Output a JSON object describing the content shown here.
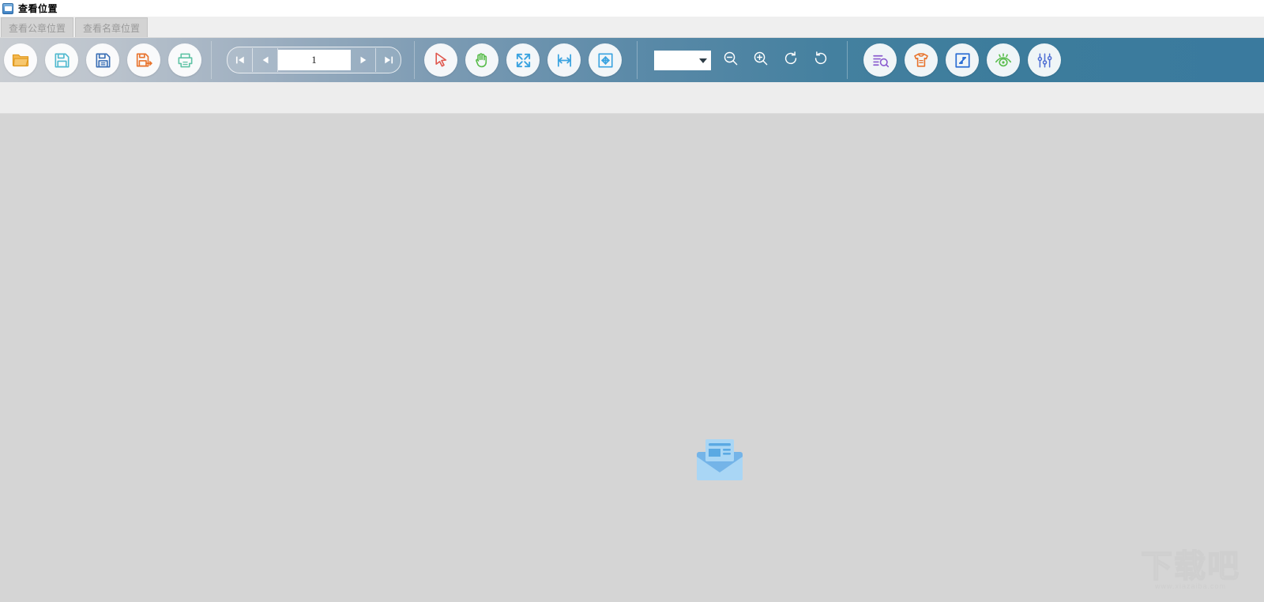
{
  "window": {
    "title": "查看位置",
    "app_icon": "app-window-icon"
  },
  "tabs": [
    {
      "id": "tab-official-seal",
      "label": "查看公章位置",
      "active": false
    },
    {
      "id": "tab-name-seal",
      "label": "查看名章位置",
      "active": false
    }
  ],
  "toolbar": {
    "file_group": [
      {
        "name": "open-file-button",
        "icon": "open-folder-icon",
        "color": "#f0a737"
      },
      {
        "name": "save-button",
        "icon": "save-floppy-icon",
        "color": "#4fb9cf"
      },
      {
        "name": "save-as-button",
        "icon": "save-as-floppy-icon",
        "color": "#3a6fb5"
      },
      {
        "name": "export-button",
        "icon": "save-export-arrow-icon",
        "color": "#e8732c"
      },
      {
        "name": "print-button",
        "icon": "printer-icon",
        "color": "#5fc3a5"
      }
    ],
    "pager": {
      "first_label": "first-page",
      "prev_label": "previous-page",
      "next_label": "next-page",
      "last_label": "last-page",
      "page_value": "1",
      "page_placeholder": ""
    },
    "tools_group": [
      {
        "name": "select-tool-button",
        "icon": "cursor-arrow-icon",
        "color": "#e0584f"
      },
      {
        "name": "pan-tool-button",
        "icon": "hand-grab-icon",
        "color": "#59bd4c"
      },
      {
        "name": "fit-screen-button",
        "icon": "expand-arrows-icon",
        "color": "#3aa3e0"
      },
      {
        "name": "fit-width-button",
        "icon": "fit-width-icon",
        "color": "#3aa3e0"
      },
      {
        "name": "fit-page-button",
        "icon": "fit-page-icon",
        "color": "#3aa3e0"
      }
    ],
    "zoom": {
      "select_value": "",
      "select_placeholder": "",
      "zoom_out": "zoom-out-button",
      "zoom_in": "zoom-in-button",
      "rotate_left": "rotate-left-button",
      "rotate_right": "rotate-right-button"
    },
    "right_group": [
      {
        "name": "search-text-button",
        "icon": "search-document-icon",
        "color": "#8a5ccf"
      },
      {
        "name": "seal-stamp-button",
        "icon": "stamp-shirt-icon",
        "color": "#e8732c"
      },
      {
        "name": "crop-region-button",
        "icon": "crop-frame-icon",
        "color": "#2d6fd4"
      },
      {
        "name": "preview-button",
        "icon": "eye-preview-icon",
        "color": "#59bd4c"
      },
      {
        "name": "settings-button",
        "icon": "sliders-settings-icon",
        "color": "#4f6fd4"
      }
    ]
  },
  "viewer": {
    "placeholder_icon": "empty-document-tray-icon",
    "watermark_cn": "下载吧",
    "watermark_url": "www.xiazaiba.com"
  },
  "colors": {
    "toolbar_left": "#c9cdd2",
    "toolbar_right": "#3a7a9e",
    "viewer_bg": "#d5d5d5",
    "subbar_bg": "#ededed",
    "tab_bg": "#d3d3d3",
    "tab_text": "#9a9a9a"
  }
}
